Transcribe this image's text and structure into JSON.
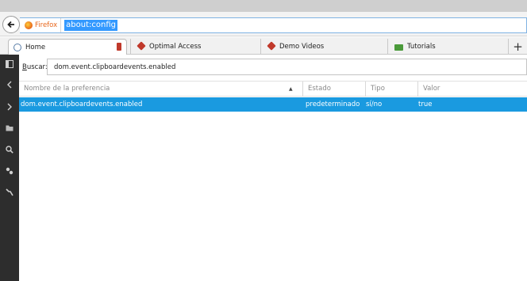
{
  "browser": {
    "identity_label": "Firefox",
    "url": "about:config"
  },
  "tabs": [
    {
      "label": "Home"
    },
    {
      "label": "Optimal Access"
    },
    {
      "label": "Demo Videos"
    },
    {
      "label": "Tutorials"
    }
  ],
  "new_tab_label": "+",
  "search": {
    "label_prefix": "B",
    "label_rest": "uscar:",
    "value": "dom.event.clipboardevents.enabled"
  },
  "table": {
    "columns": [
      "Nombre de la preferencia",
      "Estado",
      "Tipo",
      "Valor"
    ],
    "rows": [
      {
        "name": "dom.event.clipboardevents.enabled",
        "status": "predeterminado",
        "type": "sí/no",
        "value": "true"
      }
    ]
  },
  "colors": {
    "selection": "#1a9ae0",
    "url_highlight": "#3399ff",
    "sidebar_bg": "#2d2d2d",
    "firefox_orange": "#e8661b"
  }
}
